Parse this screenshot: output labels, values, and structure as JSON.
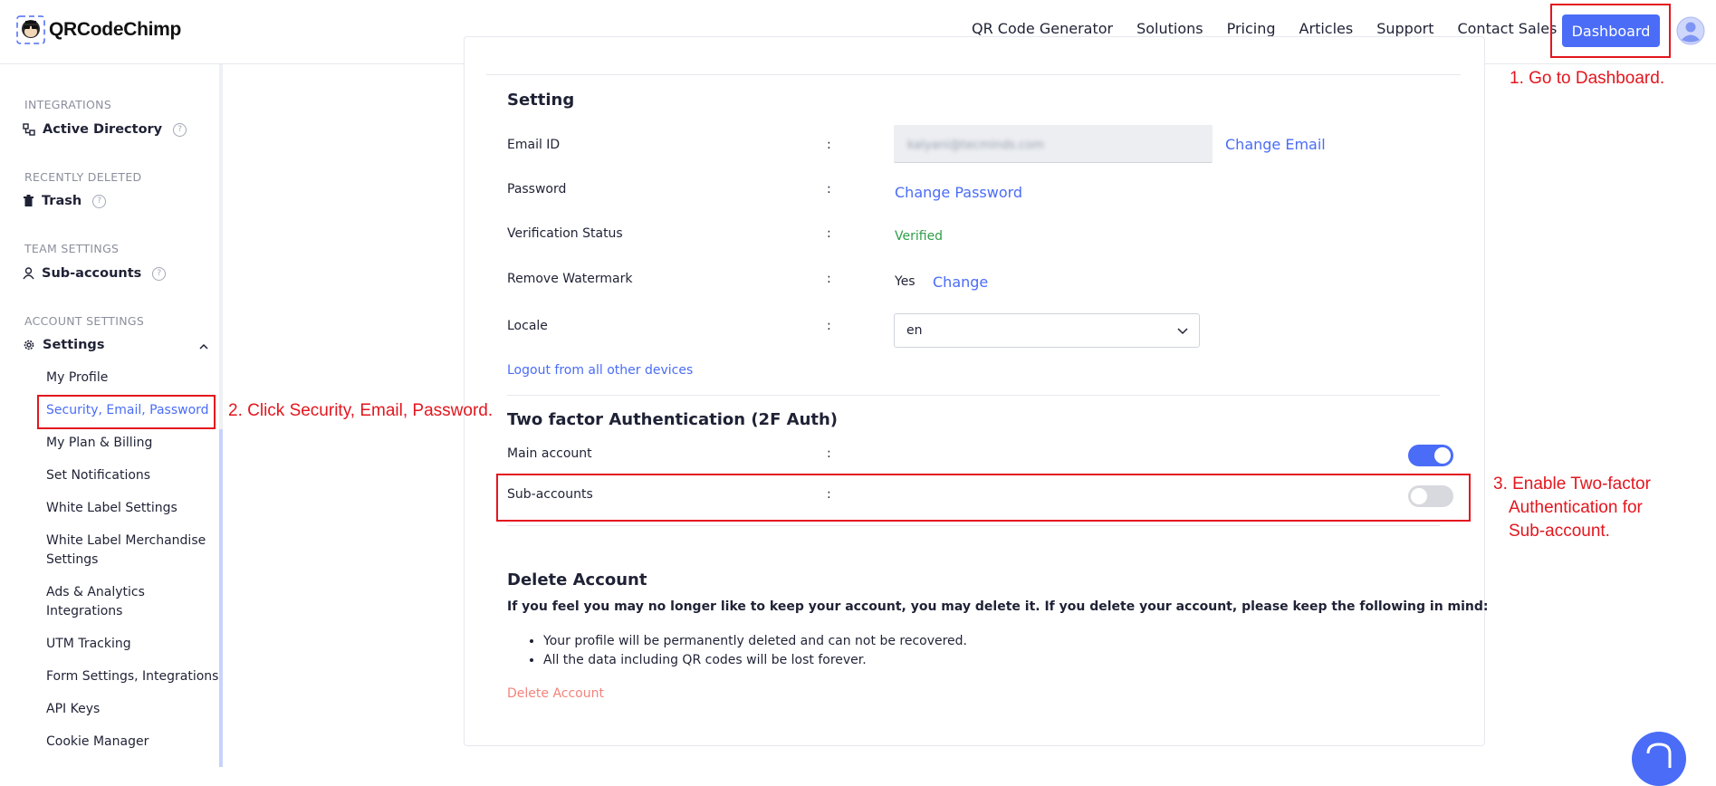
{
  "header": {
    "logo_text": "QRCodeChimp",
    "nav": [
      "QR Code Generator",
      "Solutions",
      "Pricing",
      "Articles",
      "Support",
      "Contact Sales"
    ],
    "dashboard_label": "Dashboard"
  },
  "sidebar": {
    "integrations": {
      "label": "INTEGRATIONS",
      "item": "Active Directory"
    },
    "recently_deleted": {
      "label": "RECENTLY DELETED",
      "item": "Trash"
    },
    "team_settings": {
      "label": "TEAM SETTINGS",
      "item": "Sub-accounts"
    },
    "account_settings": {
      "label": "ACCOUNT SETTINGS",
      "item": "Settings",
      "children": [
        "My Profile",
        "Security, Email, Password",
        "My Plan & Billing",
        "Set Notifications",
        "White Label Settings",
        "White Label Merchandise Settings",
        "Ads & Analytics Integrations",
        "UTM Tracking",
        "Form Settings, Integrations",
        "API Keys",
        "Cookie Manager"
      ],
      "active_index": 1
    }
  },
  "setting": {
    "title": "Setting",
    "colon": ":",
    "email": {
      "label": "Email ID",
      "value": "kalyani@tecminds.com",
      "action": "Change Email"
    },
    "password": {
      "label": "Password",
      "action": "Change Password"
    },
    "verification": {
      "label": "Verification Status",
      "value": "Verified"
    },
    "watermark": {
      "label": "Remove Watermark",
      "value": "Yes",
      "action": "Change"
    },
    "locale": {
      "label": "Locale",
      "value": "en"
    },
    "logout_link": "Logout from all other devices"
  },
  "two_factor": {
    "title": "Two factor Authentication (2F Auth)",
    "main": {
      "label": "Main account",
      "enabled": true
    },
    "sub": {
      "label": "Sub-accounts",
      "enabled": false
    }
  },
  "delete_account": {
    "title": "Delete Account",
    "warning": "If you feel you may no longer like to keep your account, you may delete it. If you delete your account, please keep the following in mind:",
    "bullets": [
      "Your profile will be permanently deleted and can not be recovered.",
      "All the data including QR codes will be lost forever."
    ],
    "action": "Delete Account"
  },
  "annotations": {
    "step1": "1. Go to Dashboard.",
    "step2": "2. Click Security, Email, Password.",
    "step3_line1": "3. Enable Two-factor",
    "step3_line2": "Authentication for",
    "step3_line3": "Sub-account."
  },
  "colors": {
    "accent": "#4a6cf7",
    "annotation": "#e3161e",
    "verified": "#2e9e48",
    "danger_link": "#f3837c"
  }
}
